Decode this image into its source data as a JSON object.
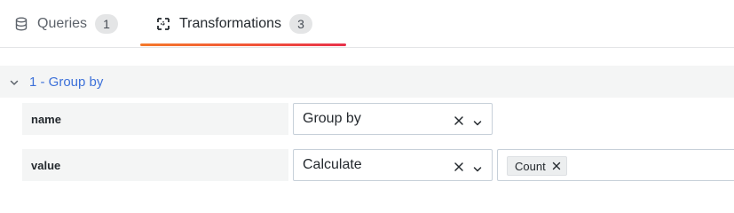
{
  "tabs": [
    {
      "label": "Queries",
      "count": "1",
      "icon": "database-icon",
      "active": false
    },
    {
      "label": "Transformations",
      "count": "3",
      "icon": "transform-icon",
      "active": true
    }
  ],
  "colors": {
    "accent_link": "#3d71d9",
    "active_tab_gradient": [
      "#f4792b",
      "#f25836",
      "#e8304a"
    ]
  },
  "section": {
    "title": "1 - Group by",
    "expanded": true
  },
  "rows": [
    {
      "label": "name",
      "value": "Group by"
    },
    {
      "label": "value",
      "value": "Calculate",
      "calculations": [
        "Count"
      ]
    }
  ]
}
